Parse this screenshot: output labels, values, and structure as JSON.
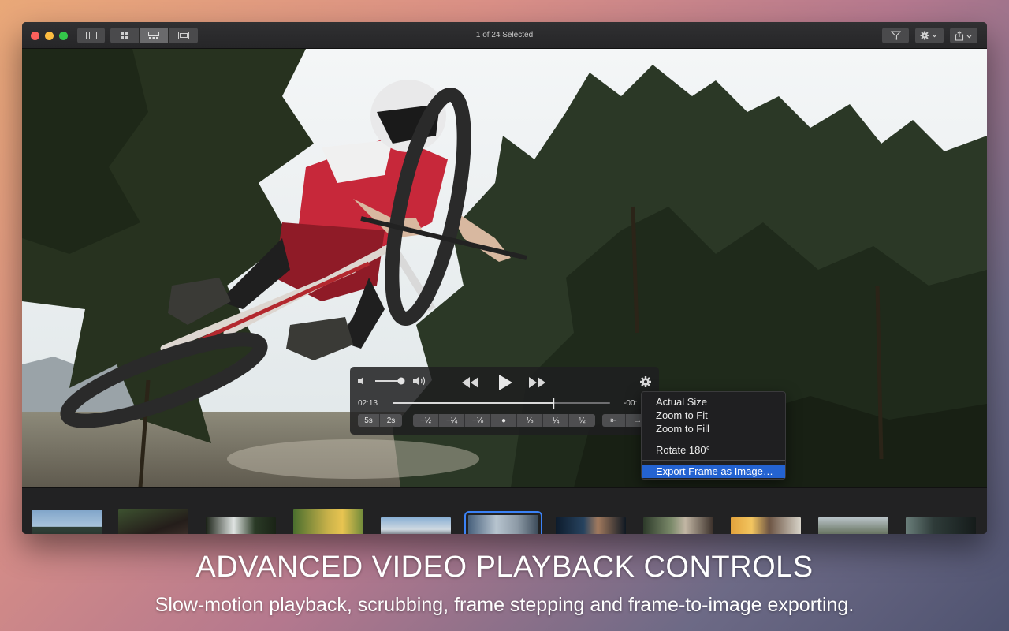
{
  "window": {
    "title": "1 of 24 Selected"
  },
  "toolbar": {
    "sidebar_icon": "sidebar-icon",
    "view_modes": [
      "grid-small-icon",
      "grid-large-icon",
      "single-view-icon"
    ],
    "active_view_mode": 1,
    "filter_icon": "filter-icon",
    "gear_icon": "gear-icon",
    "share_icon": "share-icon"
  },
  "player": {
    "current_time": "02:13",
    "remaining_time": "-00:",
    "progress": 0.74,
    "volume": 0.75,
    "skip_buttons": [
      "5s",
      "2s"
    ],
    "speed_buttons": [
      "−½",
      "−¼",
      "−⅛",
      "●",
      "⅛",
      "¼",
      "½"
    ],
    "step_buttons": [
      "⇤",
      "→"
    ]
  },
  "context_menu": {
    "items": [
      "Actual Size",
      "Zoom to Fit",
      "Zoom to Fill",
      "Rotate 180°",
      "Export Frame as Image…"
    ],
    "highlighted": "Export Frame as Image…"
  },
  "filmstrip": {
    "count": 11,
    "selected_index": 5
  },
  "caption": {
    "title": "ADVANCED VIDEO PLAYBACK CONTROLS",
    "subtitle": "Slow-motion playback, scrubbing, frame stepping and frame-to-image exporting."
  },
  "colors": {
    "accent": "#2463d1",
    "selection": "#3b82f6"
  }
}
